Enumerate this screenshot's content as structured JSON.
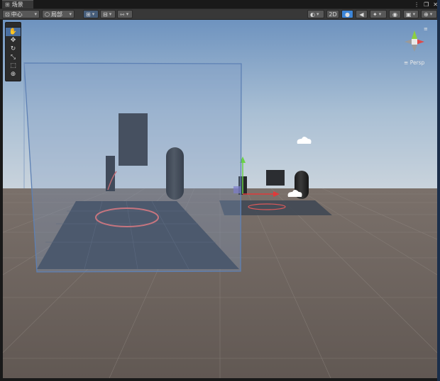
{
  "window": {
    "tab_label": "场景",
    "tab_icon": "grid-icon",
    "more_glyph": "⋮",
    "restore_glyph": "❐",
    "close_glyph": "✕"
  },
  "toolbar": {
    "pivot_label": "中心",
    "space_label": "局部",
    "mode_2d_label": "2D",
    "accent_color": "#3d86d8"
  },
  "palette": {
    "tools": [
      {
        "name": "hand-tool",
        "glyph": "✋"
      },
      {
        "name": "move-tool",
        "glyph": "✥"
      },
      {
        "name": "rotate-tool",
        "glyph": "↻"
      },
      {
        "name": "scale-tool",
        "glyph": "⤡"
      },
      {
        "name": "rect-tool",
        "glyph": "⬚"
      },
      {
        "name": "transform-tool",
        "glyph": "⊕"
      }
    ]
  },
  "gizmo": {
    "projection_label": "Persp",
    "projection_glyph": "≡"
  }
}
